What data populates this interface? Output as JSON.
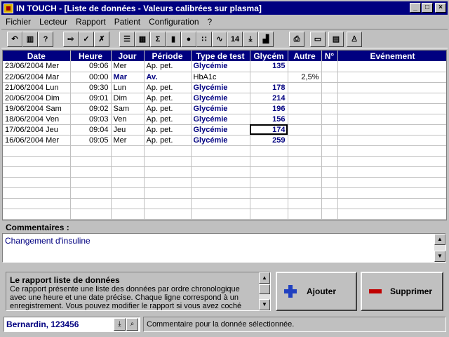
{
  "window": {
    "title": "IN TOUCH - [Liste de données - Valeurs calibrées sur plasma]",
    "controls": [
      "_",
      "□",
      "×"
    ]
  },
  "menu": [
    "Fichier",
    "Lecteur",
    "Rapport",
    "Patient",
    "Configuration",
    "?"
  ],
  "toolbar": [
    {
      "icon": "back-arrow-icon",
      "glyph": "↶"
    },
    {
      "icon": "device-icon",
      "glyph": "▥"
    },
    {
      "icon": "help-icon",
      "glyph": "?"
    },
    {
      "icon": "import-data-icon",
      "glyph": "⇨"
    },
    {
      "icon": "validate-data-icon",
      "glyph": "✓"
    },
    {
      "icon": "delete-data-icon",
      "glyph": "✗"
    },
    {
      "icon": "list-report-icon",
      "glyph": "☰"
    },
    {
      "icon": "table-report-icon",
      "glyph": "▦"
    },
    {
      "icon": "statistics-icon",
      "glyph": "Σ"
    },
    {
      "icon": "bar-chart-icon",
      "glyph": "▮"
    },
    {
      "icon": "pie-chart-icon",
      "glyph": "●"
    },
    {
      "icon": "scatter-chart-icon",
      "glyph": "∷"
    },
    {
      "icon": "line-chart-icon",
      "glyph": "∿"
    },
    {
      "icon": "calendar-14-icon",
      "glyph": "14"
    },
    {
      "icon": "download-icon",
      "glyph": "⤓"
    },
    {
      "icon": "histogram-icon",
      "glyph": "▟"
    },
    {
      "icon": "print-icon",
      "glyph": "⎙"
    },
    {
      "icon": "computer-icon",
      "glyph": "▭"
    },
    {
      "icon": "patient-card-icon",
      "glyph": "▤"
    },
    {
      "icon": "person-icon",
      "glyph": "♙"
    }
  ],
  "grid": {
    "columns": [
      "Date",
      "Heure",
      "Jour",
      "Période",
      "Type de test",
      "Glycém",
      "Autre",
      "N°",
      "Evénement"
    ],
    "rows": [
      [
        "23/06/2004 Mer",
        "09:06",
        "Mer",
        "Ap. pet.",
        "Glycémie",
        "135",
        "",
        "",
        ""
      ],
      [
        "22/06/2004 Mar",
        "00:00",
        "Mar",
        "Av.",
        "HbA1c",
        "",
        "2,5%",
        "",
        ""
      ],
      [
        "21/06/2004 Lun",
        "09:30",
        "Lun",
        "Ap. pet.",
        "Glycémie",
        "178",
        "",
        "",
        ""
      ],
      [
        "20/06/2004 Dim",
        "09:01",
        "Dim",
        "Ap. pet.",
        "Glycémie",
        "214",
        "",
        "",
        ""
      ],
      [
        "19/06/2004 Sam",
        "09:02",
        "Sam",
        "Ap. pet.",
        "Glycémie",
        "196",
        "",
        "",
        ""
      ],
      [
        "18/06/2004 Ven",
        "09:03",
        "Ven",
        "Ap. pet.",
        "Glycémie",
        "156",
        "",
        "",
        ""
      ],
      [
        "17/06/2004 Jeu",
        "09:04",
        "Jeu",
        "Ap. pet.",
        "Glycémie",
        "174",
        "",
        "",
        ""
      ],
      [
        "16/06/2004 Mer",
        "09:05",
        "Mer",
        "Ap. pet.",
        "Glycémie",
        "259",
        "",
        "",
        ""
      ]
    ],
    "selected": {
      "row": 6,
      "col": 5
    }
  },
  "comments": {
    "label": "Commentaires :",
    "text": "Changement d'insuline"
  },
  "help": {
    "title": "Le rapport liste de données",
    "body": "Ce rapport présente une liste des données par ordre chronologique avec une heure et une date précise. Chaque ligne correspond à un enregistrement. Vous pouvez modifier le rapport si vous avez coché"
  },
  "buttons": {
    "add": "Ajouter",
    "delete": "Supprimer"
  },
  "status": {
    "patient": "Bernardin, 123456",
    "message": "Commentaire pour la donnée sélectionnée."
  }
}
